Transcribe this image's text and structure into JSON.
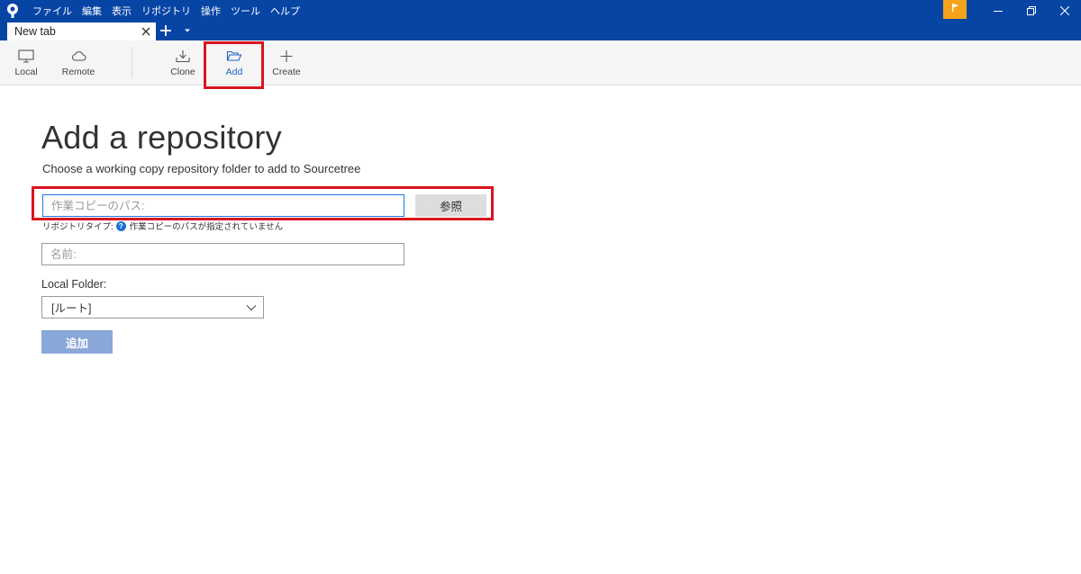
{
  "menu": [
    "ファイル",
    "編集",
    "表示",
    "リポジトリ",
    "操作",
    "ツール",
    "ヘルプ"
  ],
  "tab": {
    "label": "New tab"
  },
  "toolbar": {
    "local": "Local",
    "remote": "Remote",
    "clone": "Clone",
    "add": "Add",
    "create": "Create"
  },
  "page": {
    "title": "Add a repository",
    "subtitle": "Choose a working copy repository folder to add to Sourcetree"
  },
  "form": {
    "path_placeholder": "作業コピーのパス:",
    "browse_label": "参照",
    "repo_type_label": "リポジトリタイプ:",
    "repo_type_status": "作業コピーのパスが指定されていません",
    "name_placeholder": "名前:",
    "local_folder_label": "Local Folder:",
    "local_folder_value": "[ルート]",
    "submit_label": "追加"
  },
  "colors": {
    "titlebar": "#0745a5",
    "accent": "#1c63c6",
    "highlight": "#d9141f",
    "flag": "#f5a31a"
  }
}
